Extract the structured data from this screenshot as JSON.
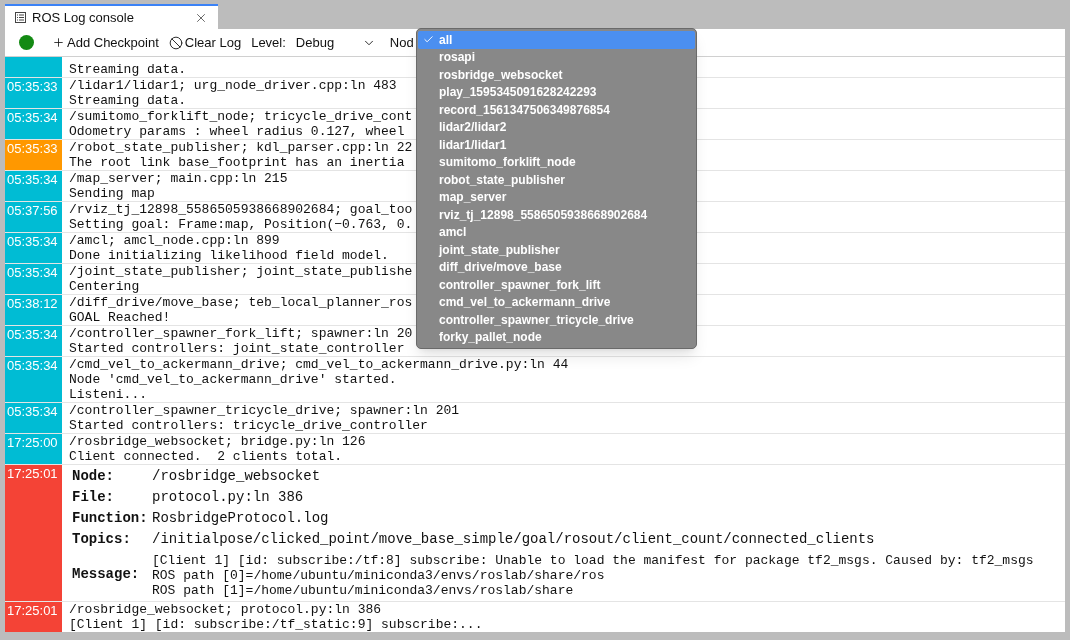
{
  "tab": {
    "title": "ROS Log console"
  },
  "toolbar": {
    "status_dot": {
      "color": "#138a13"
    },
    "add_checkpoint": "Add Checkpoint",
    "clear_log": "Clear Log",
    "level_label": "Level:",
    "level_value": "Debug",
    "node_label": "Nod"
  },
  "log": [
    {
      "kind": "partial",
      "color": "#00bcd4",
      "lines": [
        "Streaming data."
      ]
    },
    {
      "kind": "simple",
      "color": "#00bcd4",
      "time": "05:35:33",
      "lines": [
        "/lidar1/lidar1; urg_node_driver.cpp:ln 483",
        "Streaming data."
      ]
    },
    {
      "kind": "simple",
      "color": "#00bcd4",
      "time": "05:35:34",
      "lines": [
        "/sumitomo_forklift_node; tricycle_drive_cont",
        "Odometry params : wheel radius 0.127, wheel"
      ]
    },
    {
      "kind": "simple",
      "color": "#ff9800",
      "time": "05:35:33",
      "lines": [
        "/robot_state_publisher; kdl_parser.cpp:ln 22",
        "The root link base_footprint has an inertia"
      ]
    },
    {
      "kind": "simple",
      "color": "#00bcd4",
      "time": "05:35:34",
      "lines": [
        "/map_server; main.cpp:ln 215",
        "Sending map"
      ]
    },
    {
      "kind": "simple",
      "color": "#00bcd4",
      "time": "05:37:56",
      "lines": [
        "/rviz_tj_12898_5586505938668902684; goal_too",
        "Setting goal: Frame:map, Position(−0.763, 0."
      ]
    },
    {
      "kind": "simple",
      "color": "#00bcd4",
      "time": "05:35:34",
      "lines": [
        "/amcl; amcl_node.cpp:ln 899",
        "Done initializing likelihood field model."
      ]
    },
    {
      "kind": "simple",
      "color": "#00bcd4",
      "time": "05:35:34",
      "lines": [
        "/joint_state_publisher; joint_state_publishe",
        "Centering"
      ]
    },
    {
      "kind": "simple",
      "color": "#00bcd4",
      "time": "05:38:12",
      "lines": [
        "/diff_drive/move_base; teb_local_planner_ros",
        "GOAL Reached!"
      ]
    },
    {
      "kind": "simple",
      "color": "#00bcd4",
      "time": "05:35:34",
      "lines": [
        "/controller_spawner_fork_lift; spawner:ln 20",
        "Started controllers: joint_state_controller"
      ]
    },
    {
      "kind": "simple",
      "color": "#00bcd4",
      "time": "05:35:34",
      "lines": [
        "/cmd_vel_to_ackermann_drive; cmd_vel_to_ackermann_drive.py:ln 44",
        "Node 'cmd_vel_to_ackermann_drive' started.",
        "Listeni..."
      ]
    },
    {
      "kind": "simple",
      "color": "#00bcd4",
      "time": "05:35:34",
      "lines": [
        "/controller_spawner_tricycle_drive; spawner:ln 201",
        "Started controllers: tricycle_drive_controller"
      ]
    },
    {
      "kind": "simple",
      "color": "#00bcd4",
      "time": "17:25:00",
      "lines": [
        "/rosbridge_websocket; bridge.py:ln 126",
        "Client connected.  2 clients total."
      ]
    },
    {
      "kind": "detail",
      "color": "#f44336",
      "time": "17:25:01",
      "fields": [
        {
          "label": "Node:",
          "value": "/rosbridge_websocket"
        },
        {
          "label": "File:",
          "value": "protocol.py:ln 386"
        },
        {
          "label": "Function:",
          "value": "RosbridgeProtocol.log"
        },
        {
          "label": "Topics:",
          "value": "/initialpose/clicked_point/move_base_simple/goal/rosout/client_count/connected_clients"
        }
      ],
      "message_label": "Message:",
      "message": [
        "[Client 1] [id: subscribe:/tf:8] subscribe: Unable to load the manifest for package tf2_msgs. Caused by: tf2_msgs",
        "ROS path [0]=/home/ubuntu/miniconda3/envs/roslab/share/ros",
        "ROS path [1]=/home/ubuntu/miniconda3/envs/roslab/share"
      ]
    },
    {
      "kind": "simple",
      "color": "#f44336",
      "time": "17:25:01",
      "lines": [
        "/rosbridge_websocket; protocol.py:ln 386",
        "[Client 1] [id: subscribe:/tf_static:9] subscribe:..."
      ]
    }
  ],
  "node_menu": [
    {
      "label": "all",
      "selected": true
    },
    {
      "label": "rosapi",
      "selected": false
    },
    {
      "label": "rosbridge_websocket",
      "selected": false
    },
    {
      "label": "play_1595345091628242293",
      "selected": false
    },
    {
      "label": "record_1561347506349876854",
      "selected": false
    },
    {
      "label": "lidar2/lidar2",
      "selected": false
    },
    {
      "label": "lidar1/lidar1",
      "selected": false
    },
    {
      "label": "sumitomo_forklift_node",
      "selected": false
    },
    {
      "label": "robot_state_publisher",
      "selected": false
    },
    {
      "label": "map_server",
      "selected": false
    },
    {
      "label": "rviz_tj_12898_5586505938668902684",
      "selected": false
    },
    {
      "label": "amcl",
      "selected": false
    },
    {
      "label": "joint_state_publisher",
      "selected": false
    },
    {
      "label": "diff_drive/move_base",
      "selected": false
    },
    {
      "label": "controller_spawner_fork_lift",
      "selected": false
    },
    {
      "label": "cmd_vel_to_ackermann_drive",
      "selected": false
    },
    {
      "label": "controller_spawner_tricycle_drive",
      "selected": false
    },
    {
      "label": "forky_pallet_node",
      "selected": false
    }
  ]
}
